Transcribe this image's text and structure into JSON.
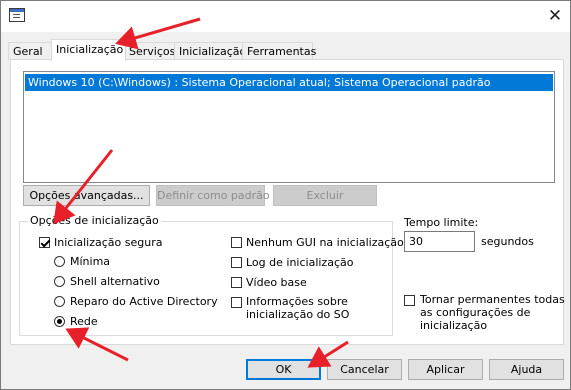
{
  "titlebar": {
    "close_glyph": "✕",
    "app_icon": "system-config-icon"
  },
  "tabs": [
    {
      "label": "Geral"
    },
    {
      "label": "Inicialização",
      "active": true
    },
    {
      "label": "Serviços"
    },
    {
      "label": "Inicialização"
    },
    {
      "label": "Ferramentas"
    }
  ],
  "boot_entries": [
    {
      "label": "Windows 10 (C:\\Windows) : Sistema Operacional atual; Sistema Operacional padrão",
      "selected": true
    }
  ],
  "list_buttons": {
    "advanced": "Opções avançadas...",
    "set_default": "Definir como padrão",
    "delete": "Excluir"
  },
  "boot_options": {
    "title": "Opções de inicialização",
    "safe_boot": {
      "label": "Inicialização segura",
      "checked": true
    },
    "radios": [
      {
        "label": "Mínima",
        "checked": false
      },
      {
        "label": "Shell alternativo",
        "checked": false
      },
      {
        "label": "Reparo do Active Directory",
        "checked": false
      },
      {
        "label": "Rede",
        "checked": true
      }
    ],
    "checks": [
      {
        "label": "Nenhum GUI na inicialização",
        "checked": false
      },
      {
        "label": "Log de inicialização",
        "checked": false
      },
      {
        "label": "Vídeo base",
        "checked": false
      },
      {
        "label_line1": "Informações sobre",
        "label_line2": "inicialização do SO",
        "checked": false
      }
    ]
  },
  "timeout": {
    "label": "Tempo limite:",
    "value": "30",
    "unit": "segundos"
  },
  "permanent": {
    "line1": "Tornar permanentes todas",
    "line2": "as configurações de",
    "line3": "inicialização",
    "checked": false
  },
  "footer": {
    "ok": "OK",
    "cancel": "Cancelar",
    "apply": "Aplicar",
    "help": "Ajuda"
  },
  "colors": {
    "selection": "#0078d7",
    "annotation_arrow": "#e8202a"
  }
}
